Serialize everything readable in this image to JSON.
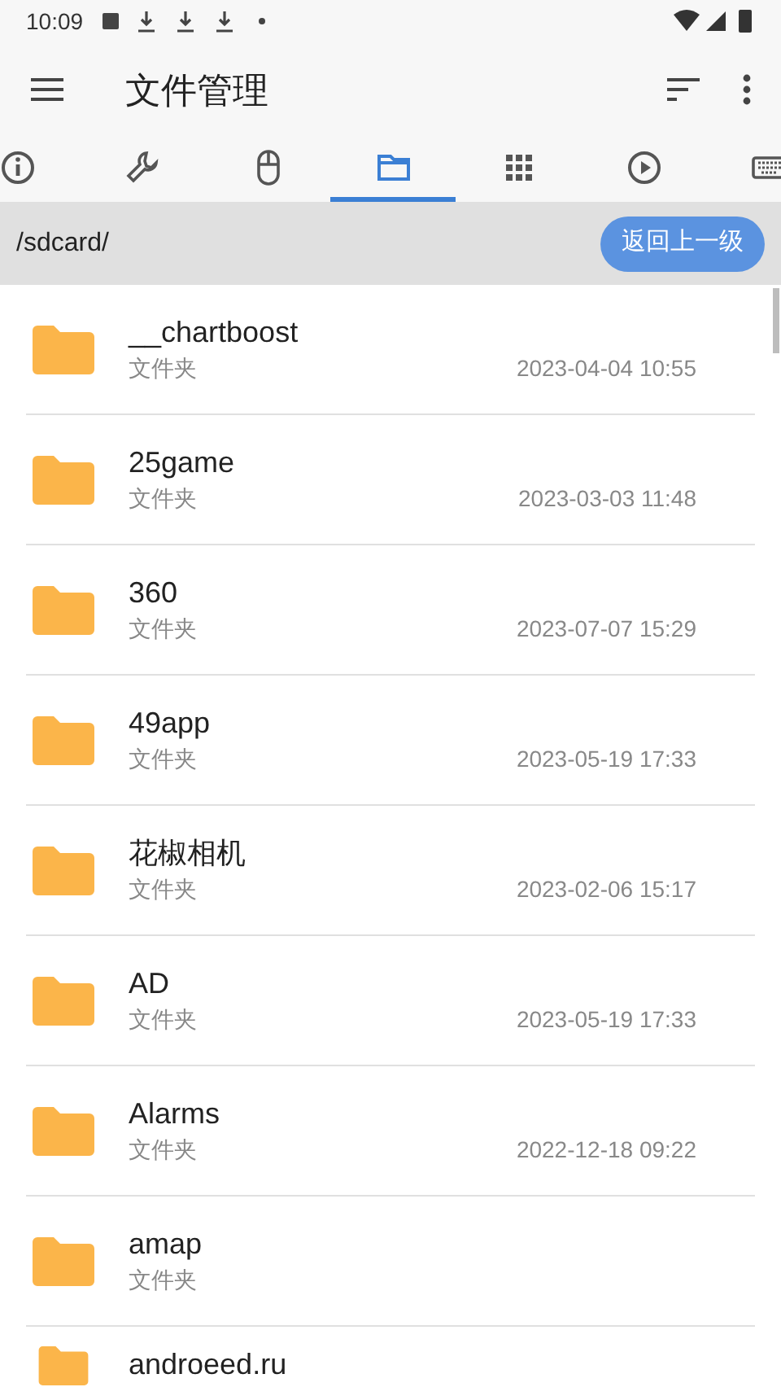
{
  "status_bar": {
    "time": "10:09"
  },
  "app_bar": {
    "title": "文件管理"
  },
  "tabs": [
    {
      "kind": "info",
      "selected": false
    },
    {
      "kind": "wrench",
      "selected": false
    },
    {
      "kind": "mouse",
      "selected": false
    },
    {
      "kind": "folder",
      "selected": true
    },
    {
      "kind": "grid",
      "selected": false
    },
    {
      "kind": "play",
      "selected": false
    },
    {
      "kind": "keyboard",
      "selected": false
    }
  ],
  "path_bar": {
    "path": "/sdcard/",
    "button": "返回上一级"
  },
  "files": [
    {
      "name": "__chartboost",
      "type": "文件夹",
      "date": "2023-04-04 10:55"
    },
    {
      "name": "25game",
      "type": "文件夹",
      "date": "2023-03-03 11:48"
    },
    {
      "name": "360",
      "type": "文件夹",
      "date": "2023-07-07 15:29"
    },
    {
      "name": "49app",
      "type": "文件夹",
      "date": "2023-05-19 17:33"
    },
    {
      "name": "花椒相机",
      "type": "文件夹",
      "date": "2023-02-06 15:17"
    },
    {
      "name": "AD",
      "type": "文件夹",
      "date": "2023-05-19 17:33"
    },
    {
      "name": "Alarms",
      "type": "文件夹",
      "date": "2022-12-18 09:22"
    },
    {
      "name": "amap",
      "type": "文件夹"
    },
    {
      "name": "androeed.ru"
    }
  ]
}
